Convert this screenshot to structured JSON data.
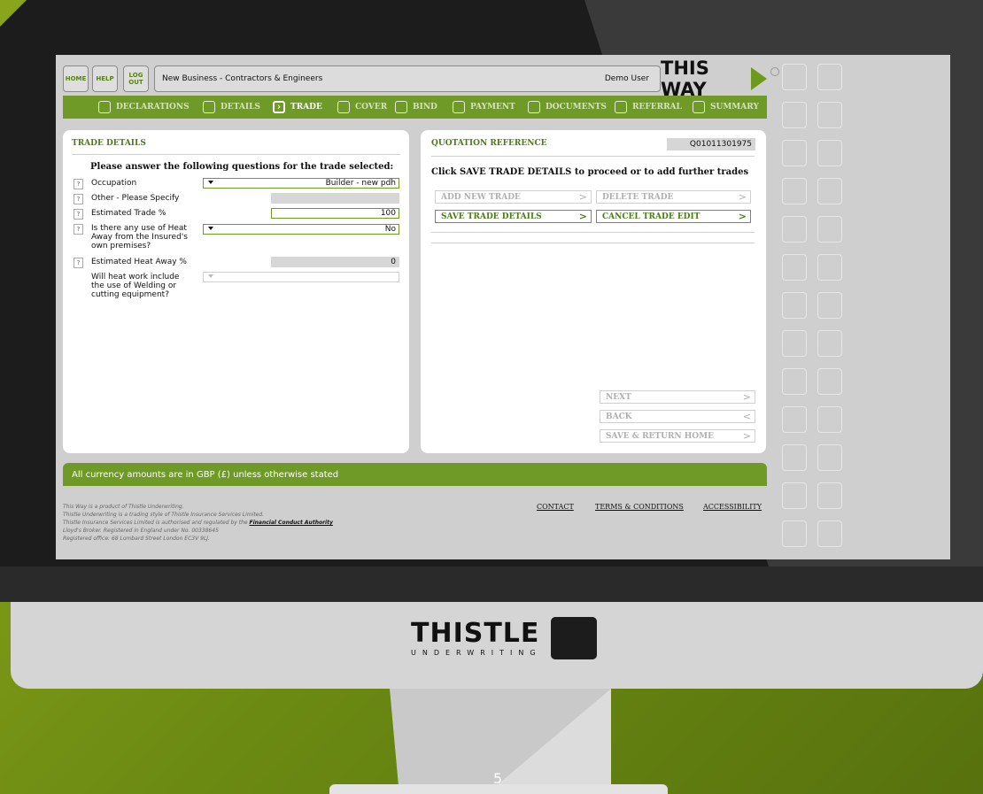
{
  "topbar": {
    "home": "HOME",
    "help": "HELP",
    "logout": "LOG OUT",
    "title": "New Business - Contractors & Engineers",
    "user": "Demo User",
    "logo": "THIS WAY"
  },
  "steps": [
    {
      "label": "DECLARATIONS",
      "active": false
    },
    {
      "label": "DETAILS",
      "active": false
    },
    {
      "label": "TRADE",
      "active": true
    },
    {
      "label": "COVER",
      "active": false
    },
    {
      "label": "BIND",
      "active": false
    },
    {
      "label": "PAYMENT",
      "active": false
    },
    {
      "label": "DOCUMENTS",
      "active": false
    },
    {
      "label": "REFERRAL",
      "active": false
    },
    {
      "label": "SUMMARY",
      "active": false
    }
  ],
  "trade": {
    "title": "TRADE DETAILS",
    "heading": "Please answer the following questions for the trade selected:",
    "help_mark": "?",
    "occupation_label": "Occupation",
    "occupation_value": "Builder - new pdh",
    "other_label": "Other - Please Specify",
    "other_value": "",
    "est_trade_label": "Estimated Trade %",
    "est_trade_value": "100",
    "heat_away_label": "Is there any use of Heat Away from the Insured's own premises?",
    "heat_away_value": "No",
    "est_heat_label": "Estimated Heat Away %",
    "est_heat_value": "0",
    "welding_label": "Will heat work include the use of Welding or cutting equipment?",
    "welding_value": ""
  },
  "quote": {
    "title": "QUOTATION REFERENCE",
    "reference": "Q01011301975",
    "instruction": "Click SAVE TRADE DETAILS to proceed or to add further trades",
    "add_new": "ADD NEW TRADE",
    "delete": "DELETE TRADE",
    "save": "SAVE TRADE DETAILS",
    "cancel": "CANCEL TRADE EDIT",
    "next": "NEXT",
    "back": "BACK",
    "save_return": "SAVE & RETURN HOME"
  },
  "currency_note": "All currency amounts are in GBP (£) unless otherwise stated",
  "footer": {
    "line1": "This Way is a product of Thistle Underwriting.",
    "line2": "Thistle Underwriting is a trading style of Thistle Insurance Services Limited.",
    "line3_pre": "Thistle Insurance Services Limited is authorised and regulated by the ",
    "line3_link": "Financial Conduct Authority",
    "line4": "Lloyd's Broker. Registered in England under No. 00338645",
    "line5": "Registered office: 68 Lombard Street London EC3V 9LJ.",
    "contact": "CONTACT",
    "terms": "TERMS & CONDITIONS",
    "accessibility": "ACCESSIBILITY"
  },
  "brand": {
    "word": "THISTLE",
    "sub": "UNDERWRITING"
  },
  "page_number": "5",
  "colors": {
    "accent": "#6f9a28",
    "title_green": "#4c7c18",
    "background": "#7d9a16"
  }
}
